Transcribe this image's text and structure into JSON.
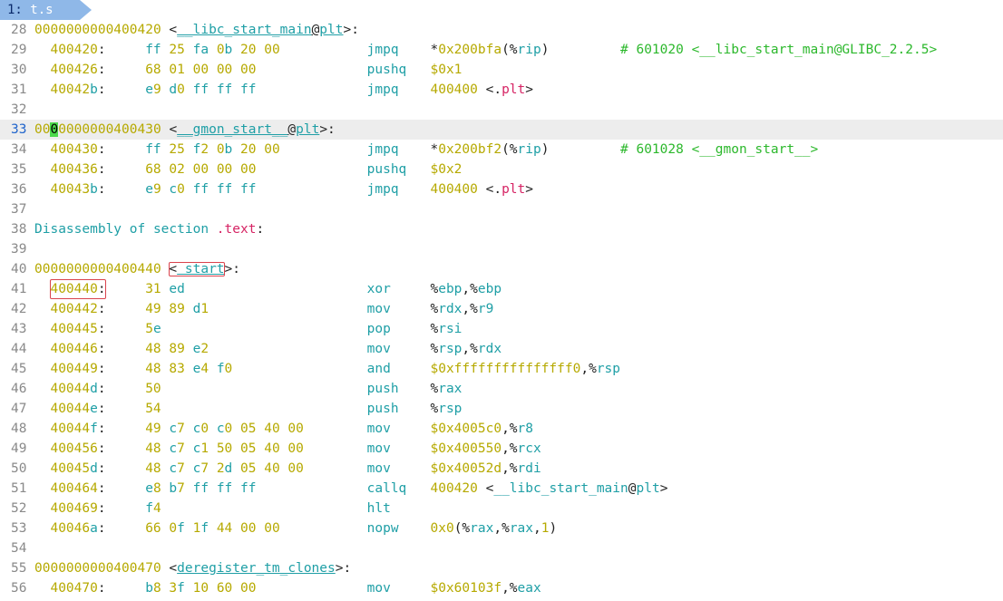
{
  "tab": {
    "num": "1:",
    "name": "t.s"
  },
  "colors": {
    "address": "#b6a900",
    "mnemonic": "#1f9fa6",
    "comment": "#2cb82c",
    "section": "#d62464",
    "highlight_box": "#d9434d",
    "cursor": "#4cd94c"
  },
  "lines": [
    {
      "n": "28",
      "kind": "label",
      "addr": "0000000000400420",
      "open": "<",
      "name": "__libc_start_main",
      "at": "@",
      "sec": "plt",
      "close": ">:"
    },
    {
      "n": "29",
      "kind": "ins",
      "addr": "400420:",
      "bytes": "ff 25 fa 0b 20 00",
      "mn": "jmpq",
      "ops": "*0x200bfa(%rip)",
      "comment": "# 601020 <__libc_start_main@GLIBC_2.2.5>"
    },
    {
      "n": "30",
      "kind": "ins",
      "addr": "400426:",
      "bytes": "68 01 00 00 00",
      "mn": "pushq",
      "ops": "$0x1"
    },
    {
      "n": "31",
      "kind": "ins",
      "addr": "40042b:",
      "bytes": "e9 d0 ff ff ff",
      "mn": "jmpq",
      "ops": "400400 <.plt>"
    },
    {
      "n": "32",
      "kind": "blank"
    },
    {
      "n": "33",
      "kind": "label",
      "cur": true,
      "addr": "0000000000400430",
      "open": "<",
      "name": "__gmon_start__",
      "at": "@",
      "sec": "plt",
      "close": ">:"
    },
    {
      "n": "34",
      "kind": "ins",
      "addr": "400430:",
      "bytes": "ff 25 f2 0b 20 00",
      "mn": "jmpq",
      "ops": "*0x200bf2(%rip)",
      "comment": "# 601028 <__gmon_start__>"
    },
    {
      "n": "35",
      "kind": "ins",
      "addr": "400436:",
      "bytes": "68 02 00 00 00",
      "mn": "pushq",
      "ops": "$0x2"
    },
    {
      "n": "36",
      "kind": "ins",
      "addr": "40043b:",
      "bytes": "e9 c0 ff ff ff",
      "mn": "jmpq",
      "ops": "400400 <.plt>"
    },
    {
      "n": "37",
      "kind": "blank"
    },
    {
      "n": "38",
      "kind": "section",
      "text": "Disassembly of section",
      "sec": ".text",
      "close": ":"
    },
    {
      "n": "39",
      "kind": "blank"
    },
    {
      "n": "40",
      "kind": "label",
      "boxed": true,
      "addr": "0000000000400440",
      "open": "<",
      "name": "_start",
      "at": "",
      "sec": "",
      "close": ">:"
    },
    {
      "n": "41",
      "kind": "ins",
      "boxed": true,
      "addr": "400440:",
      "bytes": "31 ed",
      "mn": "xor",
      "ops": "%ebp,%ebp"
    },
    {
      "n": "42",
      "kind": "ins",
      "addr": "400442:",
      "bytes": "49 89 d1",
      "mn": "mov",
      "ops": "%rdx,%r9"
    },
    {
      "n": "43",
      "kind": "ins",
      "addr": "400445:",
      "bytes": "5e",
      "mn": "pop",
      "ops": "%rsi"
    },
    {
      "n": "44",
      "kind": "ins",
      "addr": "400446:",
      "bytes": "48 89 e2",
      "mn": "mov",
      "ops": "%rsp,%rdx"
    },
    {
      "n": "45",
      "kind": "ins",
      "addr": "400449:",
      "bytes": "48 83 e4 f0",
      "mn": "and",
      "ops": "$0xfffffffffffffff0,%rsp"
    },
    {
      "n": "46",
      "kind": "ins",
      "addr": "40044d:",
      "bytes": "50",
      "mn": "push",
      "ops": "%rax"
    },
    {
      "n": "47",
      "kind": "ins",
      "addr": "40044e:",
      "bytes": "54",
      "mn": "push",
      "ops": "%rsp"
    },
    {
      "n": "48",
      "kind": "ins",
      "addr": "40044f:",
      "bytes": "49 c7 c0 c0 05 40 00",
      "mn": "mov",
      "ops": "$0x4005c0,%r8"
    },
    {
      "n": "49",
      "kind": "ins",
      "addr": "400456:",
      "bytes": "48 c7 c1 50 05 40 00",
      "mn": "mov",
      "ops": "$0x400550,%rcx"
    },
    {
      "n": "50",
      "kind": "ins",
      "addr": "40045d:",
      "bytes": "48 c7 c7 2d 05 40 00",
      "mn": "mov",
      "ops": "$0x40052d,%rdi"
    },
    {
      "n": "51",
      "kind": "ins",
      "addr": "400464:",
      "bytes": "e8 b7 ff ff ff",
      "mn": "callq",
      "ops": "400420 <__libc_start_main@plt>"
    },
    {
      "n": "52",
      "kind": "ins",
      "addr": "400469:",
      "bytes": "f4",
      "mn": "hlt",
      "ops": ""
    },
    {
      "n": "53",
      "kind": "ins",
      "addr": "40046a:",
      "bytes": "66 0f 1f 44 00 00",
      "mn": "nopw",
      "ops": "0x0(%rax,%rax,1)"
    },
    {
      "n": "54",
      "kind": "blank"
    },
    {
      "n": "55",
      "kind": "label",
      "addr": "0000000000400470",
      "open": "<",
      "name": "deregister_tm_clones",
      "at": "",
      "sec": "",
      "close": ">:"
    },
    {
      "n": "56",
      "kind": "ins",
      "addr": "400470:",
      "bytes": "b8 3f 10 60 00",
      "mn": "mov",
      "ops": "$0x60103f,%eax"
    }
  ]
}
